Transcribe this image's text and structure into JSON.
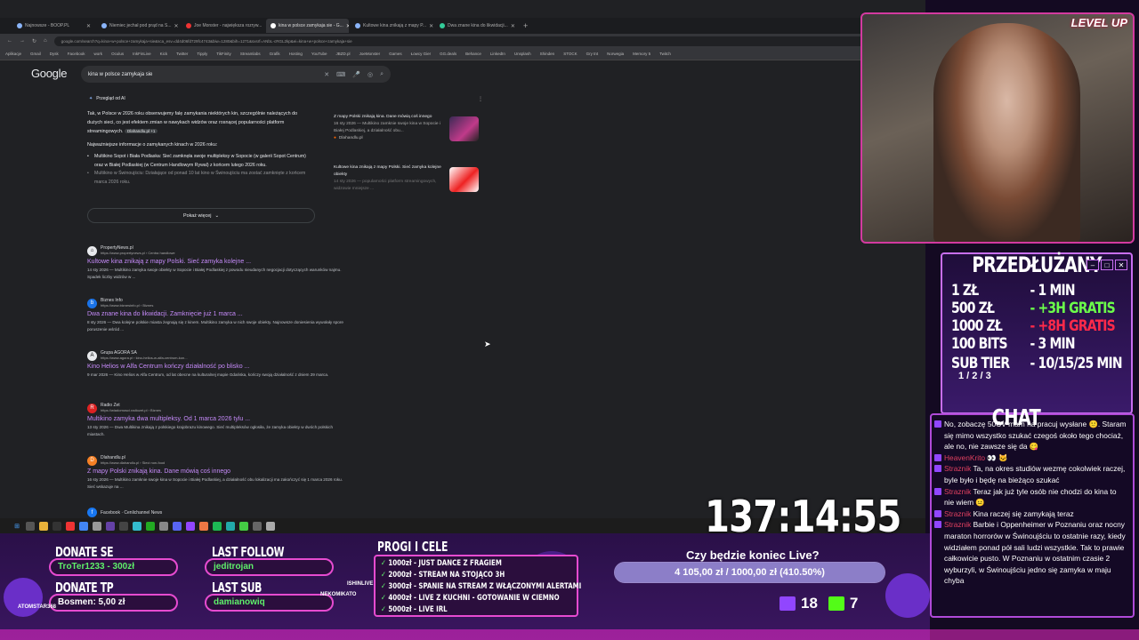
{
  "browser": {
    "tabs": [
      {
        "label": "Najnowsze - BOOP.PL",
        "active": false
      },
      {
        "label": "Niemiec jechał pod prąd na S...",
        "active": false
      },
      {
        "label": "Joe Monster - największa rozryw...",
        "active": false
      },
      {
        "label": "kina w polsce zamykaja sie - G...",
        "active": true
      },
      {
        "label": "Kultowe kina znikają z mapy P...",
        "active": false
      },
      {
        "label": "Dwa znane kina do likwidacji...",
        "active": false
      }
    ],
    "url": "google.com/search?q=kina+w+polsce+zamykaja+sie&sca_esv=dd4d06fd729fc4743&biw=1280&bih=1271&sxsrf=ANbL-cRGL2kp&ei=kina+w+polsce+zamykaja+sie",
    "bookmarks": [
      "Aplikacje",
      "Gmail",
      "Dysk",
      "Facebook",
      "work",
      "Oculus",
      "InkFinLive",
      "Kick",
      "Twitter",
      "Tipply",
      "TikFinity",
      "Streamlabs",
      "Grafik",
      "Hosting",
      "YouTube",
      "JBZD.pl",
      "JoeMonster",
      "Games",
      "Łowcy Gier",
      "GG.deals",
      "Behance",
      "LinkedIn",
      "Unsplash",
      "Shinden",
      "STOCK",
      "Gry tnt",
      "Norwegia",
      "Memory 5",
      "Twitch"
    ]
  },
  "google": {
    "logo": "Google",
    "query": "kina w polsce zamykaja sie",
    "ai_overview_label": "Przegląd od AI",
    "ai_text": "Tak, w Polsce w 2026 roku obserwujemy falę zamykania niektórych kin, szczególnie należących do dużych sieci, co jest efektem zmian w nawykach widzów oraz rosnącej popularności platform streamingowych.",
    "ai_source_chip": "Dlahandlu.pl +1",
    "ai_subhead": "Najważniejsze informacje o zamykanych kinach w 2026 roku:",
    "ai_bullets": [
      "Multikino Sopot i Biała Podlaska: Sieć zamknęła swoje multipleksy w Sopocie (w galerii Sopot Centrum) oraz w Białej Podlaskiej (w Centrum Handlowym Rywal) z końcem lutego 2026 roku.",
      "Multikino w Świnoujściu: Działające od ponad 10 lat kino w Świnoujściu ma zostać zamknięte z końcem marca 2026 roku."
    ],
    "ai_sources": [
      {
        "title": "Z mapy Polski znikają kina. Dane mówią coś innego",
        "meta": "16 sty 2026 — Multikino zamknie swoje kina w Sopocie i Białej Podlaskiej, a działalność obu...",
        "site": "Dlahandlu.pl"
      },
      {
        "title": "Kultowe kina znikają z mapy Polski. Sieć zamyka kolejne obiekty",
        "meta": "14 sty 2026 — popularności platform streamingowych, widzowie mniejsze ...",
        "site": ""
      }
    ],
    "show_more": "Pokaż więcej",
    "results": [
      {
        "icon": "⌂",
        "site": "PropertyNews.pl",
        "url": "https://www.propertynews.pl › Centra handlowe",
        "title": "Kultowe kina znikają z mapy Polski. Sieć zamyka kolejne ...",
        "snippet": "14 sty 2026 — Multikino zamyka swoje obiekty w Sopocie i Białej Podlaskiej z powodu nieudanych negocjacji dotyczących warunków najmu. Spadek liczby widzów w ..."
      },
      {
        "icon": "b",
        "site": "Biznes Info",
        "url": "https://www.biznesinfo.pl › Biznes",
        "title": "Dwa znane kina do likwidacji. Zamknięcie już 1 marca ...",
        "snippet": "8 sty 2026 — Dwa kolejne polskie miasta żegnają się z kinem. Multikino zamyka w nich swoje obiekty. Najnowsze doniesienia wywołały spore poruszenie wśród ..."
      },
      {
        "icon": "A",
        "site": "Grupa AGORA SA",
        "url": "https://www.agora.pl › kino-helios-w-alfa-centrum-kon...",
        "title": "Kino Helios w Alfa Centrum kończy działalność po blisko ...",
        "snippet": "9 mar 2026 — Kino Helios w Alfa Centrum, od lat obecne na kulturalnej mapie Gdańska, kończy swoją działalność z dniem 29 marca."
      },
      {
        "icon": "R",
        "site": "Radio Zet",
        "url": "https://wiadomosci.radiozet.pl › Biznes",
        "title": "Multikino zamyka dwa multipleksy. Od 1 marca 2026 tylu ...",
        "snippet": "13 sty 2026 — Dwa Multikina znikają z polskiego krajobrazu kinowego. Sieć multipleksów ogłosiła, że zamyka obiekty w dwóch polskich miastach."
      },
      {
        "icon": "D",
        "site": "Dlahandlu.pl",
        "url": "https://www.dlahandlu.pl › Sieci non-food",
        "title": "Z mapy Polski znikają kina. Dane mówią coś innego",
        "snippet": "16 sty 2026 — Multikino zamknie swoje kina w Sopocie i Białej Podlaskiej, a działalność obu lokalizacji ma zakończyć się 1 marca 2026 roku. Sieć wskazuje na ..."
      },
      {
        "icon": "f",
        "site": "Facebook · Cenlichannel News",
        "url": "",
        "title": "",
        "snippet": ""
      }
    ]
  },
  "overlay": {
    "cam_logo": "LEVEL UP",
    "prices_title": "PRZEDŁUŻANY",
    "prices": [
      {
        "amount": "1 ZŁ",
        "value": "- 1 MIN",
        "color": "#ffffff"
      },
      {
        "amount": "500 ZŁ",
        "value": "- +3H GRATIS",
        "color": "#6bff4a"
      },
      {
        "amount": "1000 ZŁ",
        "value": "- +8H GRATIS",
        "color": "#ff2a4a"
      },
      {
        "amount": "100 BITS",
        "value": "- 3 MIN",
        "color": "#ffffff"
      },
      {
        "amount": "SUB TIER",
        "value": "- 10/15/25 MIN",
        "color": "#ffffff"
      }
    ],
    "sub_tier_sub": "1 / 2 / 3",
    "chat_title": "CHAT",
    "chat": [
      {
        "user": "",
        "text": "No, zobaczę 50CV mam na pracuj wysłane 🙂. Staram się mimo wszystko szukać czegoś około tego chociaż, ale no, nie zawsze się da 😋"
      },
      {
        "user": "HeavenKrito",
        "text": "👀 🐱"
      },
      {
        "user": "Straznik",
        "text": "Ta, na okres studiów wezmę cokolwiek raczej, byle było i będę na bieżąco szukać"
      },
      {
        "user": "Straznik",
        "text": "Teraz jak już tyle osób nie chodzi do kina to nie wiem 😐"
      },
      {
        "user": "Straznik",
        "text": "Kina raczej się zamykają teraz"
      },
      {
        "user": "Straznik",
        "text": "Barbie i Oppenheimer w Poznaniu oraz nocny maraton horrorów w Świnoujściu to ostatnie razy, kiedy widziałem ponad pół sali ludzi wszystkie. Tak to prawie całkowicie pusto. W Poznaniu w ostatnim czasie 2 wyburzyli, w Świnoujściu jedno się zamyka w maju chyba"
      }
    ],
    "timer": "137:14:55",
    "donate_label": "DONATE SE",
    "donate_value": "TroTer1233 - 300zł",
    "donate_tp_label": "DONATE TP",
    "donate_tp_value": "Bosmen: 5,00 zł",
    "last_follow_label": "LAST FOLLOW",
    "last_follow_value": "jeditrojan",
    "last_sub_label": "LAST SUB",
    "last_sub_value": "damianowiq",
    "goals_title": "PROGI I CELE",
    "goals": [
      "1000zł - JUST DANCE Z FRAGIEM",
      "2000zł - STREAM NA STOJĄCO 3H",
      "3000zł - SPANIE NA STREAM Z WŁĄCZONYMI ALERTAMI",
      "4000zł - LIVE Z KUCHNI - GOTOWANIE W CIEMNO",
      "5000zł - LIVE IRL"
    ],
    "goal_check": "✓",
    "side_name_1": "ISHINLIVE",
    "side_name_2": "NEKOMIKATO",
    "side_name_3": "ATOMSTAR368",
    "end_question": "Czy będzie koniec Live?",
    "progress_text": "4 105,00 zł / 1000,00 zł (410.50%)",
    "progress_fraction": 1.0,
    "twitch_count": "18",
    "kick_count": "7",
    "colors": {
      "twitch": "#9146ff",
      "kick": "#53fc18",
      "accent": "#e64bd0"
    }
  }
}
